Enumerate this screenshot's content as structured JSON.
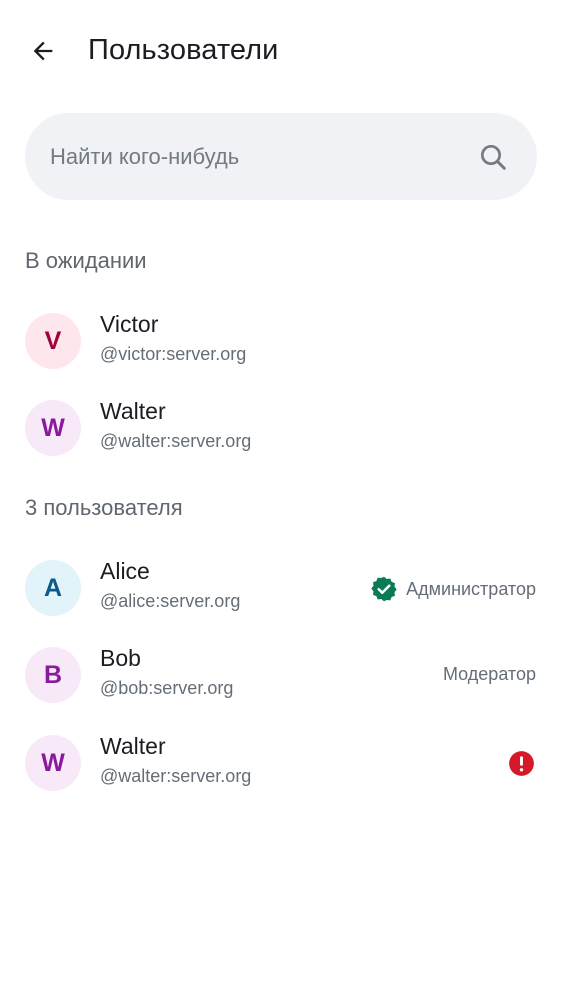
{
  "header": {
    "title": "Пользователи",
    "back_icon": "arrow-left-icon"
  },
  "search": {
    "placeholder": "Найти кого-нибудь",
    "value": "",
    "icon": "search-icon"
  },
  "pending": {
    "header": "В ожидании",
    "users": [
      {
        "initial": "V",
        "name": "Victor",
        "handle": "@victor:server.org",
        "avatar_bg": "#fde7ec",
        "avatar_fg": "#a3003f"
      },
      {
        "initial": "W",
        "name": "Walter",
        "handle": "@walter:server.org",
        "avatar_bg": "#f8e9f8",
        "avatar_fg": "#8a1a9c"
      }
    ]
  },
  "members": {
    "header": "3 пользователя",
    "users": [
      {
        "initial": "A",
        "name": "Alice",
        "handle": "@alice:server.org",
        "role": "Администратор",
        "role_icon": "verified-badge-icon",
        "avatar_bg": "#e2f3f9",
        "avatar_fg": "#0a5b8a"
      },
      {
        "initial": "B",
        "name": "Bob",
        "handle": "@bob:server.org",
        "role": "Модератор",
        "avatar_bg": "#f8e9f8",
        "avatar_fg": "#8a1a9c"
      },
      {
        "initial": "W",
        "name": "Walter",
        "handle": "@walter:server.org",
        "status_icon": "error-icon",
        "avatar_bg": "#f8e9f8",
        "avatar_fg": "#8a1a9c"
      }
    ]
  },
  "colors": {
    "admin_badge": "#0b7a57",
    "error": "#d51928",
    "search_bg": "#f0f2f5"
  }
}
